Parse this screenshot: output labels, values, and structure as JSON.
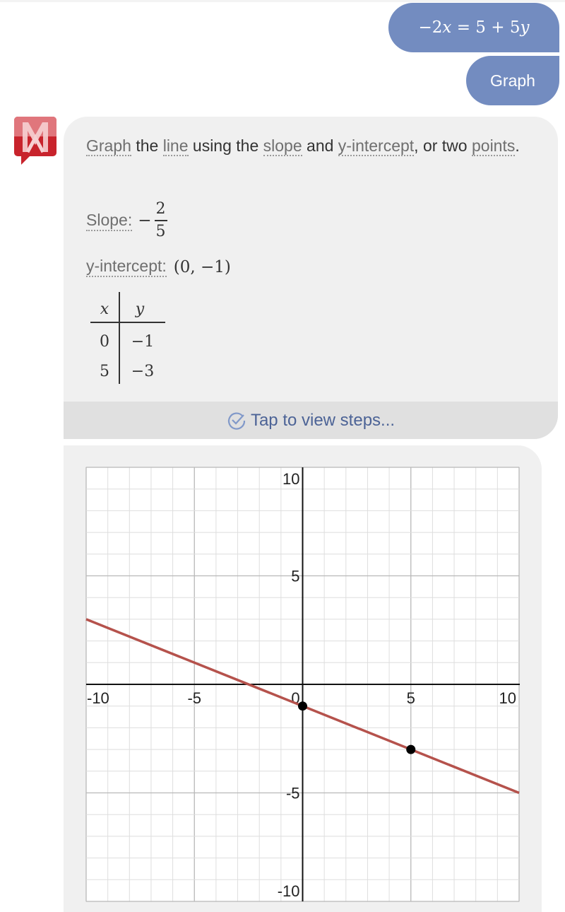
{
  "user_message": {
    "equation_parts": [
      "−2",
      "x",
      " = 5 + 5",
      "y"
    ],
    "equation_text": "−2x = 5 + 5y"
  },
  "action_button": {
    "label": "Graph"
  },
  "app": {
    "logo": "mathway-logo-icon",
    "brand_color": "#c8232c",
    "bubble_color": "#738cc0"
  },
  "answer": {
    "intro": {
      "graph": "Graph",
      "t1": " the ",
      "line": "line",
      "t2": " using the ",
      "slope": "slope",
      "t3": " and ",
      "yint": "y-intercept",
      "t4": ", or two ",
      "points": "points",
      "t5": "."
    },
    "slope_label": "Slope:",
    "slope_sign": "−",
    "slope_num": "2",
    "slope_den": "5",
    "yint_label": "y-intercept:",
    "yint_value": "(0, −1)",
    "table": {
      "headers": [
        "x",
        "y"
      ],
      "rows": [
        [
          "0",
          "−1"
        ],
        [
          "5",
          "−3"
        ]
      ]
    },
    "steps_label": "Tap to view steps..."
  },
  "chart_data": {
    "type": "line",
    "title": "",
    "xlabel": "",
    "ylabel": "",
    "xlim": [
      -10,
      10
    ],
    "ylim": [
      -10,
      10
    ],
    "grid": true,
    "x_ticks": [
      -10,
      -5,
      0,
      5,
      10
    ],
    "y_ticks": [
      -10,
      -5,
      5,
      10
    ],
    "x_tick_labels": [
      "-10",
      "-5",
      "0",
      "5",
      "10"
    ],
    "y_tick_labels": [
      "-10",
      "-5",
      "5",
      "10"
    ],
    "series": [
      {
        "name": "-2x = 5 + 5y",
        "slope": -0.4,
        "intercept": -1,
        "x": [
          -10,
          10
        ],
        "y": [
          3,
          -5
        ],
        "color": "#b5524c"
      }
    ],
    "points": [
      {
        "x": 0,
        "y": -1
      },
      {
        "x": 5,
        "y": -3
      }
    ]
  }
}
